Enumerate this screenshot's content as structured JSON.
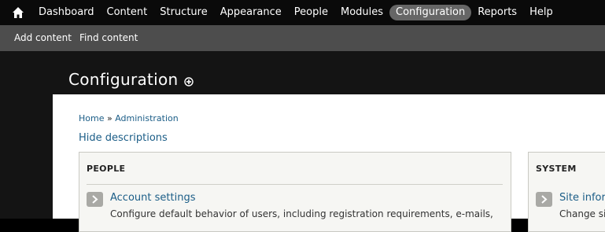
{
  "toolbar": {
    "home_icon": "home-icon",
    "items": [
      {
        "label": "Dashboard"
      },
      {
        "label": "Content"
      },
      {
        "label": "Structure"
      },
      {
        "label": "Appearance"
      },
      {
        "label": "People"
      },
      {
        "label": "Modules"
      },
      {
        "label": "Configuration",
        "active": true
      },
      {
        "label": "Reports"
      },
      {
        "label": "Help"
      }
    ]
  },
  "shortcuts": {
    "items": [
      {
        "label": "Add content"
      },
      {
        "label": "Find content"
      }
    ]
  },
  "header": {
    "title": "Configuration",
    "add_shortcut_icon": "plus-circle-icon"
  },
  "breadcrumb": {
    "home": "Home",
    "separator": "»",
    "admin": "Administration"
  },
  "hide_descriptions": "Hide descriptions",
  "panels": {
    "people": {
      "title": "PEOPLE",
      "item_label": "Account settings",
      "item_desc": "Configure default behavior of users, including registration requirements, e-mails,"
    },
    "system": {
      "title": "SYSTEM",
      "item_label": "Site infor",
      "item_desc": "Change si"
    }
  },
  "colors": {
    "toolbar_bg": "#0a0a0a",
    "shortcut_bg": "#4d4d4d",
    "link": "#1b5d87",
    "active_tab": "#666666"
  }
}
